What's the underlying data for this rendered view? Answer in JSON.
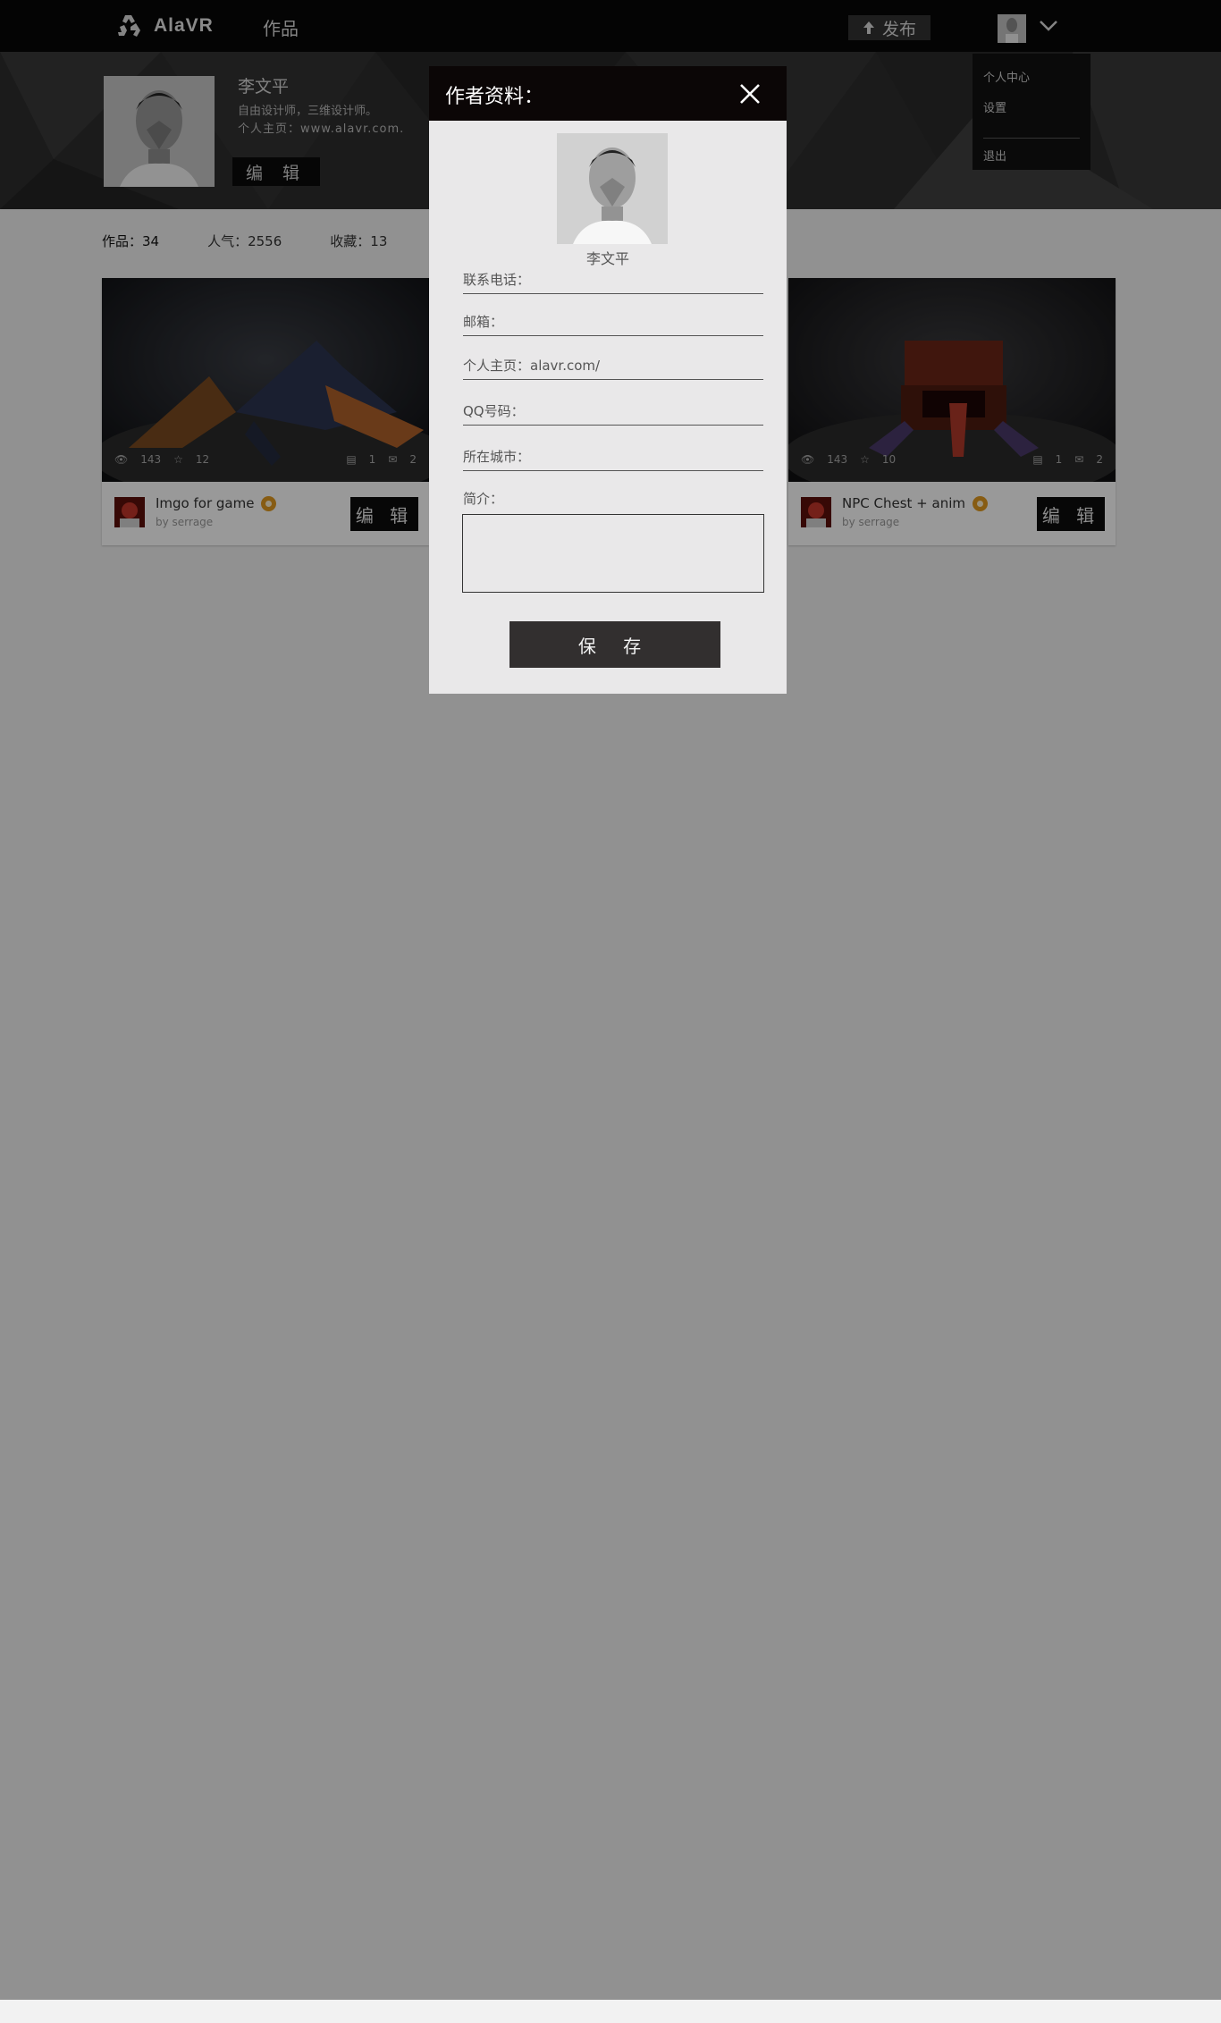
{
  "nav": {
    "brand": "AlaVR",
    "works_link": "作品",
    "publish_label": "发布",
    "user_menu": [
      "个人中心",
      "设置",
      "退出"
    ]
  },
  "profile": {
    "name": "李文平",
    "bio": "自由设计师，三维设计师。",
    "homepage": "个人主页：www.alavr.com.",
    "edit_label": "编 辑"
  },
  "stats": {
    "works": "作品：34",
    "popularity": "人气：2556",
    "favorites": "收藏：13"
  },
  "cards": [
    {
      "title": "Imgo for game",
      "author": "by serrage",
      "views": "143",
      "stars": "12",
      "media": "1",
      "comments": "2",
      "edit_label": "编 辑"
    },
    {
      "title": "NPC Chest + anim",
      "author": "by serrage",
      "views": "143",
      "stars": "10",
      "media": "1",
      "comments": "2",
      "edit_label": "编 辑"
    }
  ],
  "modal": {
    "title": "作者资料：",
    "name": "李文平",
    "fields": {
      "phone": "联系电话：",
      "email": "邮箱：",
      "homepage": "个人主页：alavr.com/",
      "qq": "QQ号码：",
      "city": "所在城市：",
      "intro": "简介："
    },
    "save_label": "保 存"
  },
  "colors": {
    "nav_bg": "#070707",
    "modal_bg": "#e9e8e9",
    "save_button": "#322f2f",
    "badge": "#e29a20",
    "overlay": "rgba(0,0,0,0.40)"
  },
  "icons": [
    "recycle-logo-icon",
    "upload-arrow-icon",
    "chevron-down-icon",
    "close-icon",
    "eye-icon",
    "star-icon",
    "film-icon",
    "comment-icon",
    "badge-icon"
  ]
}
